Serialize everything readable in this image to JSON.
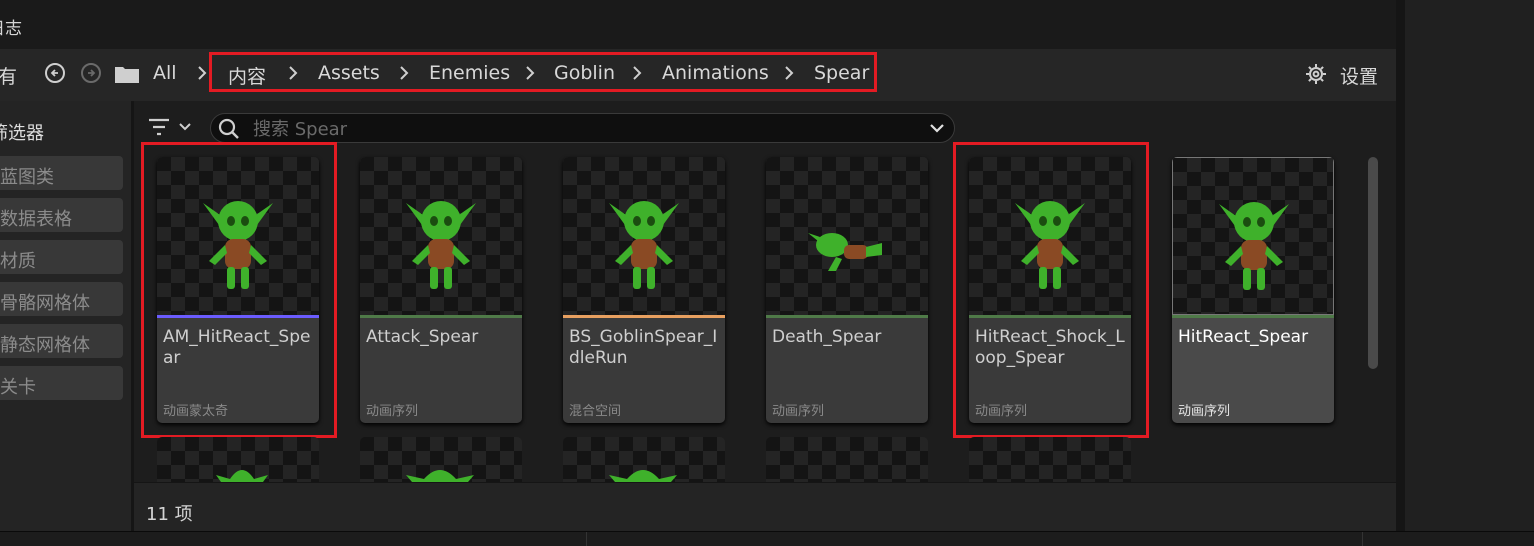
{
  "window": {
    "title": "日志"
  },
  "toolbar": {
    "left_label": "有",
    "all_label": "All",
    "breadcrumb": [
      "内容",
      "Assets",
      "Enemies",
      "Goblin",
      "Animations",
      "Spear"
    ],
    "settings_label": "设置"
  },
  "sidebar": {
    "header": "筛选器",
    "filters": [
      "蓝图类",
      "数据表格",
      "材质",
      "骨骼网格体",
      "静态网格体",
      "关卡"
    ]
  },
  "search": {
    "placeholder": "搜索 Spear",
    "value": ""
  },
  "assets": [
    {
      "name": "AM_HitReact_Spear",
      "type": "动画蒙太奇",
      "type_color": "#6b5cff",
      "highlighted": true,
      "selected": false
    },
    {
      "name": "Attack_Spear",
      "type": "动画序列",
      "type_color": "#4f7a48",
      "highlighted": false,
      "selected": false
    },
    {
      "name": "BS_GoblinSpear_IdleRun",
      "type": "混合空间",
      "type_color": "#e8a060",
      "highlighted": false,
      "selected": false
    },
    {
      "name": "Death_Spear",
      "type": "动画序列",
      "type_color": "#4f7a48",
      "highlighted": false,
      "selected": false
    },
    {
      "name": "HitReact_Shock_Loop_Spear",
      "type": "动画序列",
      "type_color": "#4f7a48",
      "highlighted": true,
      "selected": false
    },
    {
      "name": "HitReact_Spear",
      "type": "动画序列",
      "type_color": "#4f7a48",
      "highlighted": false,
      "selected": true
    }
  ],
  "status": {
    "item_count": "11 项"
  },
  "colors": {
    "highlight": "#e31b23",
    "panel": "#262626",
    "accent_green": "#4f7a48"
  }
}
